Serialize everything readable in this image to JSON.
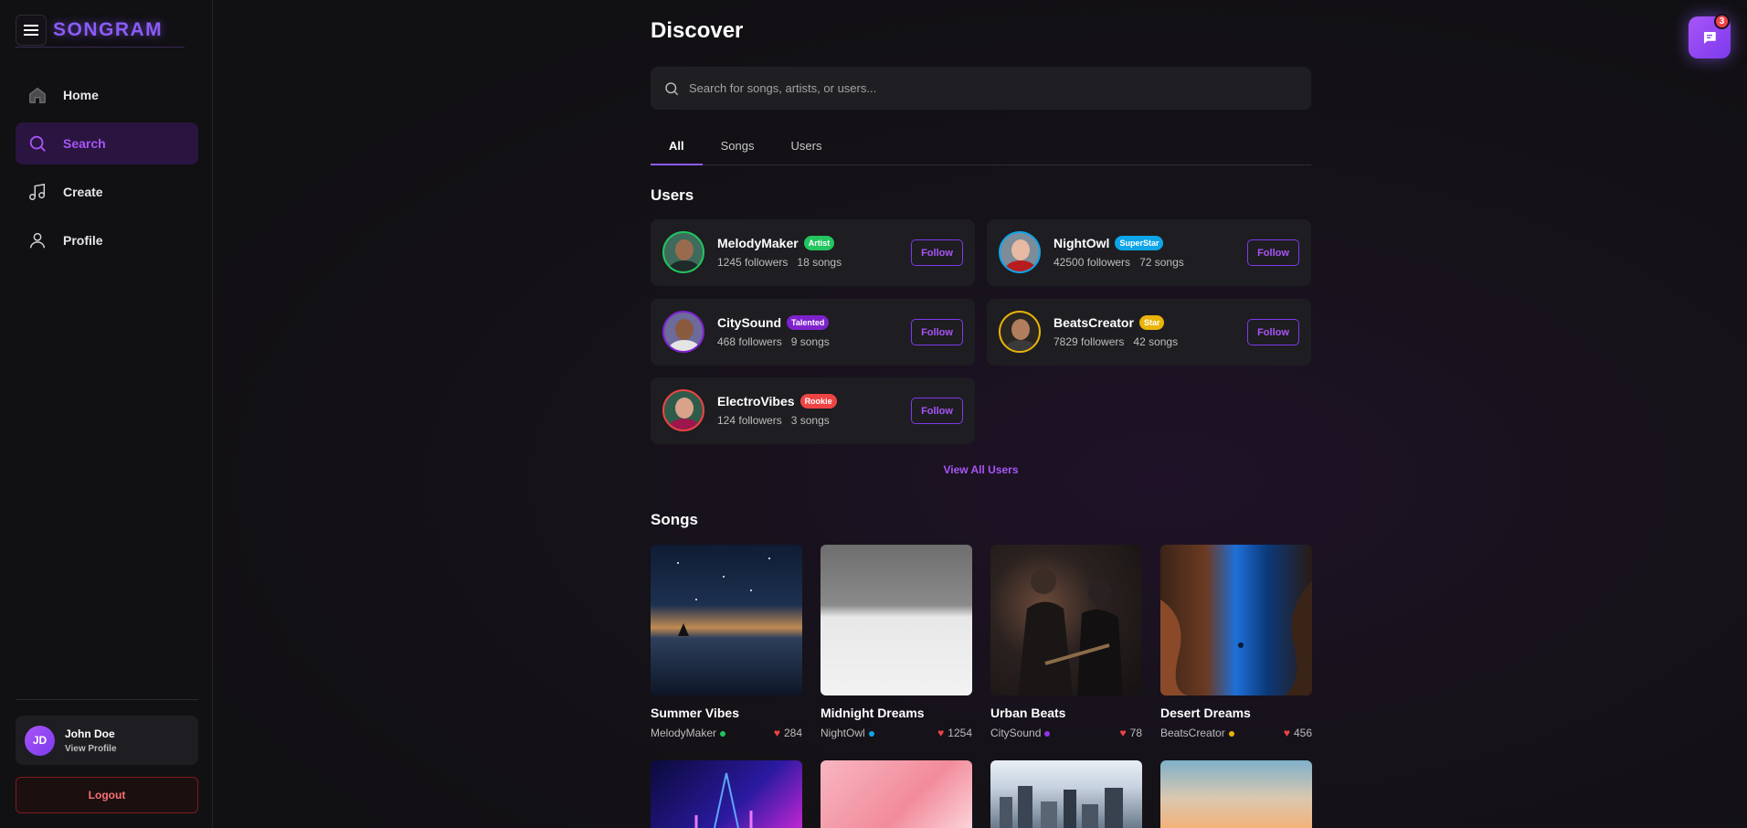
{
  "app": {
    "name": "SONGRAM"
  },
  "nav": [
    {
      "label": "Home",
      "icon": "home-icon"
    },
    {
      "label": "Search",
      "icon": "search-icon",
      "active": true
    },
    {
      "label": "Create",
      "icon": "music-note-icon"
    },
    {
      "label": "Profile",
      "icon": "user-icon"
    }
  ],
  "current_user": {
    "initials": "JD",
    "name": "John Doe",
    "link": "View Profile"
  },
  "logout_label": "Logout",
  "page": {
    "title": "Discover",
    "search_placeholder": "Search for songs, artists, or users..."
  },
  "tabs": [
    "All",
    "Songs",
    "Users"
  ],
  "users_section": {
    "title": "Users",
    "view_all": "View All Users",
    "items": [
      {
        "name": "MelodyMaker",
        "badge": "Artist",
        "badge_color": "#22c55e",
        "followers": "1245 followers",
        "songs": "18 songs",
        "follow": "Follow"
      },
      {
        "name": "NightOwl",
        "badge": "SuperStar",
        "badge_color": "#0ea5e9",
        "followers": "42500 followers",
        "songs": "72 songs",
        "follow": "Follow"
      },
      {
        "name": "CitySound",
        "badge": "Talented",
        "badge_color": "#7e22ce",
        "followers": "468 followers",
        "songs": "9 songs",
        "follow": "Follow"
      },
      {
        "name": "BeatsCreator",
        "badge": "Star",
        "badge_color": "#eab308",
        "followers": "7829 followers",
        "songs": "42 songs",
        "follow": "Follow"
      },
      {
        "name": "ElectroVibes",
        "badge": "Rookie",
        "badge_color": "#ef4444",
        "followers": "124 followers",
        "songs": "3 songs",
        "follow": "Follow"
      }
    ]
  },
  "songs_section": {
    "title": "Songs",
    "items": [
      {
        "title": "Summer Vibes",
        "artist": "MelodyMaker",
        "dot_color": "#22c55e",
        "likes": "284"
      },
      {
        "title": "Midnight Dreams",
        "artist": "NightOwl",
        "dot_color": "#0ea5e9",
        "likes": "1254"
      },
      {
        "title": "Urban Beats",
        "artist": "CitySound",
        "dot_color": "#9333ea",
        "likes": "78"
      },
      {
        "title": "Desert Dreams",
        "artist": "BeatsCreator",
        "dot_color": "#eab308",
        "likes": "456"
      }
    ]
  },
  "chat": {
    "unread": "3"
  }
}
